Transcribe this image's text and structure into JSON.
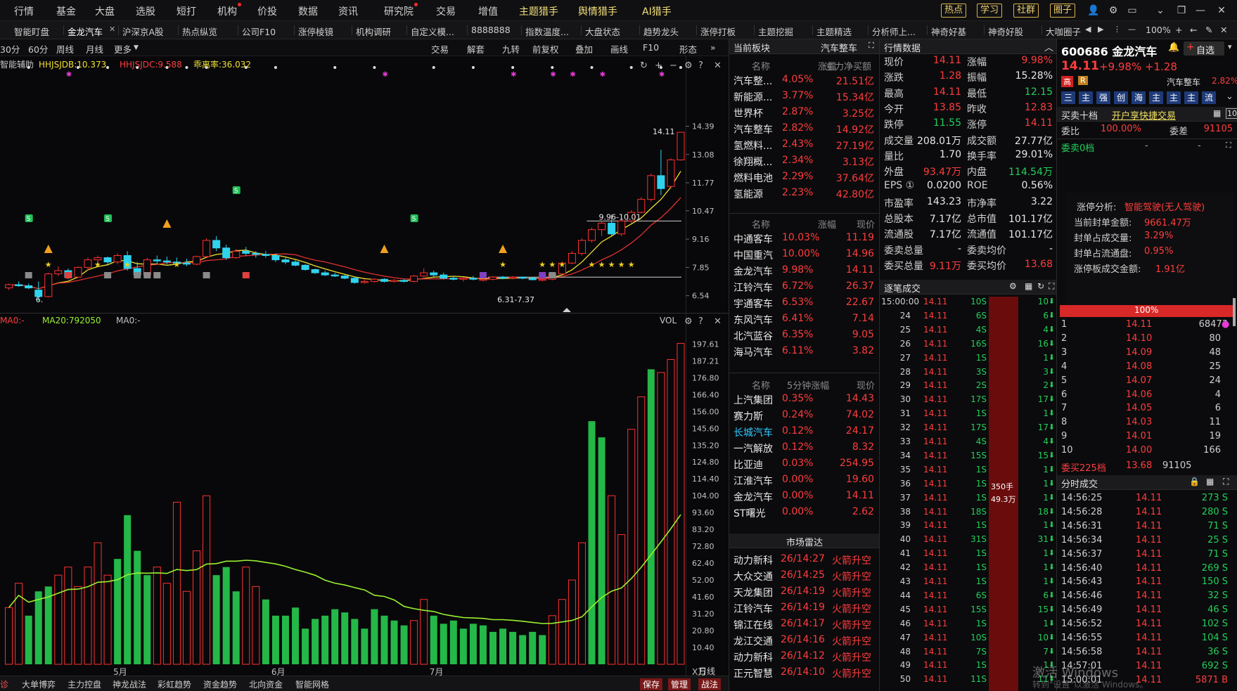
{
  "nav": {
    "items": [
      "行情",
      "基金",
      "大盘",
      "选股",
      "短打",
      "机构",
      "价投",
      "数据",
      "资讯",
      "研究院",
      "交易",
      "增值",
      "主题猎手",
      "舆情猎手",
      "AI猎手"
    ],
    "dots": [
      "机构",
      "研究院"
    ],
    "highlight": [
      "主题猎手",
      "舆情猎手",
      "AI猎手"
    ],
    "boxed": [
      "热点",
      "学习",
      "社群",
      "圈子"
    ]
  },
  "tabs": {
    "items": [
      "智能盯盘",
      "金龙汽车",
      "沪深京A股",
      "热点纵览",
      "公司F10",
      "涨停棱镜",
      "机构调研",
      "自定义模...",
      "8888888",
      "指数温度...",
      "大盘状态",
      "趋势龙头",
      "涨停打板",
      "主题挖掘",
      "主题精选",
      "分析师上...",
      "神奇好基",
      "神奇好股",
      "大咖圈子"
    ],
    "active": "金龙汽车",
    "zoom": "100%"
  },
  "chart_toolbar": {
    "periods": [
      "30分",
      "60分",
      "周线",
      "月线",
      "更多"
    ],
    "tools": [
      "交易",
      "解套",
      "九转",
      "前复权",
      "叠加",
      "画线",
      "F10",
      "形态"
    ]
  },
  "kline": {
    "indicator_name": "智能辅助",
    "ind1": "HHJSJDB:10.373",
    "ind2": "HHJSJDC:9.588",
    "ind3": "乖离率:36.032",
    "y_ticks": [
      "14.39",
      "13.08",
      "11.77",
      "10.47",
      "9.16",
      "7.85",
      "6.54"
    ],
    "ann_high": "14.11",
    "ann_range": "9.96-10.01",
    "ann_low1": "6.",
    "ann_low2": "6.31-7.37"
  },
  "volume": {
    "ma1": "MA0:-",
    "ma2": "MA20:792050",
    "ma3": "MA0:-",
    "label": "VOL",
    "unit": "X万",
    "y_ticks": [
      "197.61",
      "187.21",
      "176.80",
      "166.40",
      "156.00",
      "145.60",
      "135.20",
      "124.80",
      "114.40",
      "104.00",
      "93.60",
      "83.20",
      "72.80",
      "62.40",
      "52.00",
      "41.60",
      "31.20",
      "20.80",
      "10.40"
    ],
    "months": [
      "5月",
      "6月",
      "7月"
    ],
    "period_label": "日线"
  },
  "chart_data": {
    "type": "bar",
    "candles": [
      [
        6.9,
        7.1,
        6.8,
        7.05
      ],
      [
        7.05,
        7.2,
        6.95,
        7.0
      ],
      [
        7.0,
        7.1,
        6.85,
        6.9
      ],
      [
        6.8,
        7.2,
        6.3,
        6.5
      ],
      [
        6.5,
        7.6,
        6.45,
        7.55
      ],
      [
        7.55,
        7.9,
        7.45,
        7.7
      ],
      [
        7.7,
        7.8,
        7.3,
        7.4
      ],
      [
        7.4,
        7.9,
        7.35,
        7.85
      ],
      [
        7.85,
        8.3,
        7.7,
        8.2
      ],
      [
        8.2,
        8.4,
        8.0,
        8.3
      ],
      [
        8.3,
        8.35,
        8.0,
        8.1
      ],
      [
        8.1,
        8.5,
        8.0,
        8.4
      ],
      [
        8.4,
        8.6,
        7.7,
        7.8
      ],
      [
        7.8,
        8.1,
        7.4,
        7.5
      ],
      [
        7.5,
        8.3,
        7.45,
        8.2
      ],
      [
        8.2,
        8.4,
        8.0,
        8.15
      ],
      [
        8.15,
        8.35,
        8.0,
        8.1
      ],
      [
        8.1,
        8.3,
        8.0,
        8.05
      ],
      [
        8.05,
        8.25,
        7.9,
        8.0
      ],
      [
        8.0,
        8.4,
        7.95,
        8.35
      ],
      [
        8.35,
        9.2,
        8.3,
        9.1
      ],
      [
        9.1,
        9.3,
        8.6,
        8.75
      ],
      [
        8.75,
        8.9,
        8.2,
        8.3
      ],
      [
        8.3,
        8.7,
        8.25,
        8.6
      ],
      [
        8.6,
        8.8,
        8.4,
        8.5
      ],
      [
        8.5,
        8.6,
        8.3,
        8.45
      ],
      [
        8.45,
        8.6,
        8.3,
        8.4
      ],
      [
        8.4,
        8.5,
        8.1,
        8.2
      ],
      [
        8.2,
        8.3,
        8.0,
        8.1
      ],
      [
        8.1,
        8.2,
        7.9,
        7.95
      ],
      [
        7.95,
        8.0,
        7.7,
        7.75
      ],
      [
        7.75,
        7.8,
        7.55,
        7.6
      ],
      [
        7.6,
        7.7,
        7.45,
        7.5
      ],
      [
        7.5,
        7.6,
        7.4,
        7.45
      ],
      [
        7.45,
        7.5,
        7.3,
        7.35
      ],
      [
        7.35,
        7.4,
        7.1,
        7.15
      ],
      [
        7.15,
        7.3,
        7.1,
        7.2
      ],
      [
        7.2,
        7.35,
        7.15,
        7.3
      ],
      [
        7.3,
        7.35,
        7.15,
        7.2
      ],
      [
        7.2,
        7.3,
        7.15,
        7.25
      ],
      [
        7.25,
        7.3,
        7.15,
        7.2
      ],
      [
        7.2,
        7.5,
        7.15,
        7.45
      ],
      [
        7.45,
        7.8,
        7.4,
        7.6
      ],
      [
        7.6,
        7.7,
        7.4,
        7.5
      ],
      [
        7.5,
        7.6,
        7.3,
        7.35
      ],
      [
        7.35,
        7.45,
        7.25,
        7.3
      ],
      [
        7.3,
        7.4,
        7.2,
        7.35
      ],
      [
        7.35,
        7.45,
        7.25,
        7.3
      ],
      [
        7.3,
        7.4,
        7.2,
        7.3
      ],
      [
        7.3,
        7.45,
        7.25,
        7.4
      ],
      [
        7.4,
        7.45,
        7.3,
        7.35
      ],
      [
        7.35,
        7.45,
        7.3,
        7.4
      ],
      [
        7.4,
        7.42,
        7.3,
        7.35
      ],
      [
        7.35,
        7.4,
        7.25,
        7.28
      ],
      [
        7.28,
        7.35,
        7.2,
        7.3
      ],
      [
        7.3,
        7.6,
        7.25,
        7.55
      ],
      [
        7.55,
        8.1,
        7.5,
        8.05
      ],
      [
        8.05,
        8.6,
        8.0,
        8.5
      ],
      [
        8.5,
        9.2,
        8.4,
        9.1
      ],
      [
        9.1,
        9.7,
        9.0,
        9.6
      ],
      [
        9.6,
        10.0,
        9.3,
        9.9
      ],
      [
        9.9,
        10.3,
        9.3,
        9.4
      ],
      [
        9.4,
        10.1,
        9.3,
        10.0
      ],
      [
        10.0,
        10.5,
        9.9,
        10.4
      ],
      [
        10.4,
        11.1,
        10.35,
        11.0
      ],
      [
        11.0,
        12.2,
        10.9,
        12.1
      ],
      [
        12.1,
        13.3,
        11.2,
        11.5
      ],
      [
        11.6,
        12.9,
        11.5,
        12.83
      ],
      [
        12.83,
        14.11,
        12.8,
        14.11
      ]
    ],
    "volumes": [
      [
        35,
        1
      ],
      [
        50,
        1
      ],
      [
        30,
        0
      ],
      [
        45,
        0
      ],
      [
        48,
        0
      ],
      [
        55,
        1
      ],
      [
        60,
        1
      ],
      [
        48,
        1
      ],
      [
        60,
        1
      ],
      [
        75,
        1
      ],
      [
        55,
        1
      ],
      [
        65,
        0
      ],
      [
        92,
        0
      ],
      [
        70,
        0
      ],
      [
        55,
        0
      ],
      [
        60,
        1
      ],
      [
        50,
        1
      ],
      [
        100,
        1
      ],
      [
        45,
        1
      ],
      [
        70,
        1
      ],
      [
        104,
        1
      ],
      [
        55,
        0
      ],
      [
        60,
        0
      ],
      [
        45,
        0
      ],
      [
        60,
        1
      ],
      [
        48,
        1
      ],
      [
        40,
        0
      ],
      [
        30,
        0
      ],
      [
        30,
        0
      ],
      [
        35,
        0
      ],
      [
        22,
        0
      ],
      [
        28,
        0
      ],
      [
        30,
        0
      ],
      [
        34,
        0
      ],
      [
        32,
        0
      ],
      [
        28,
        0
      ],
      [
        22,
        0
      ],
      [
        34,
        0
      ],
      [
        30,
        0
      ],
      [
        27,
        0
      ],
      [
        24,
        0
      ],
      [
        27,
        1
      ],
      [
        40,
        1
      ],
      [
        30,
        0
      ],
      [
        25,
        0
      ],
      [
        27,
        0
      ],
      [
        22,
        0
      ],
      [
        25,
        0
      ],
      [
        24,
        0
      ],
      [
        20,
        0
      ],
      [
        22,
        0
      ],
      [
        20,
        0
      ],
      [
        18,
        0
      ],
      [
        20,
        0
      ],
      [
        18,
        0
      ],
      [
        30,
        1
      ],
      [
        40,
        1
      ],
      [
        52,
        1
      ],
      [
        75,
        1
      ],
      [
        150,
        0
      ],
      [
        140,
        0
      ],
      [
        104,
        1
      ],
      [
        80,
        1
      ],
      [
        145,
        1
      ],
      [
        165,
        1
      ],
      [
        182,
        0
      ],
      [
        180,
        1
      ],
      [
        188,
        1
      ],
      [
        198,
        1
      ]
    ],
    "y_range": [
      6.3,
      14.7
    ],
    "vol_max": 206
  },
  "sector_panel": {
    "title": "当前板块",
    "sector": "汽车整车",
    "head1": [
      "名称",
      "涨幅",
      "主力净买额"
    ],
    "rows1": [
      [
        "汽车整...",
        "4.05%",
        "21.51亿"
      ],
      [
        "新能源...",
        "3.77%",
        "15.34亿"
      ],
      [
        "世界杯",
        "2.87%",
        "3.25亿"
      ],
      [
        "汽车整车",
        "2.82%",
        "14.92亿"
      ],
      [
        "氢燃料...",
        "2.43%",
        "27.19亿"
      ],
      [
        "徐翔概...",
        "2.34%",
        "3.13亿"
      ],
      [
        "燃料电池",
        "2.29%",
        "37.64亿"
      ],
      [
        "氢能源",
        "2.23%",
        "42.80亿"
      ]
    ],
    "head2": [
      "名称",
      "涨幅",
      "现价"
    ],
    "rows2": [
      [
        "中通客车",
        "10.03%",
        "11.19"
      ],
      [
        "中国重汽",
        "10.00%",
        "14.96"
      ],
      [
        "金龙汽车",
        "9.98%",
        "14.11"
      ],
      [
        "江铃汽车",
        "6.72%",
        "26.37"
      ],
      [
        "宇通客车",
        "6.53%",
        "22.67"
      ],
      [
        "东风汽车",
        "6.41%",
        "7.14"
      ],
      [
        "北汽蓝谷",
        "6.35%",
        "9.05"
      ],
      [
        "海马汽车",
        "6.11%",
        "3.82"
      ]
    ],
    "head3": [
      "名称",
      "5分钟涨幅",
      "现价"
    ],
    "rows3": [
      [
        "上汽集团",
        "0.35%",
        "14.43"
      ],
      [
        "赛力斯",
        "0.24%",
        "74.02"
      ],
      [
        "长城汽车",
        "0.12%",
        "24.17"
      ],
      [
        "一汽解放",
        "0.12%",
        "8.32"
      ],
      [
        "比亚迪",
        "0.03%",
        "254.95"
      ],
      [
        "江淮汽车",
        "0.00%",
        "19.60"
      ],
      [
        "金龙汽车",
        "0.00%",
        "14.11"
      ],
      [
        "ST曙光",
        "0.00%",
        "2.62"
      ]
    ],
    "radar_title": "市场雷达",
    "radar": [
      [
        "动力新科",
        "26/14:27",
        "火箭升空"
      ],
      [
        "大众交通",
        "26/14:25",
        "火箭升空"
      ],
      [
        "天龙集团",
        "26/14:19",
        "火箭升空"
      ],
      [
        "江铃汽车",
        "26/14:19",
        "火箭升空"
      ],
      [
        "锦江在线",
        "26/14:17",
        "火箭升空"
      ],
      [
        "龙江交通",
        "26/14:16",
        "火箭升空"
      ],
      [
        "动力新科",
        "26/14:12",
        "火箭升空"
      ],
      [
        "正元智慧",
        "26/14:10",
        "火箭升空"
      ]
    ]
  },
  "quote": {
    "title": "行情数据",
    "rows": [
      [
        "现价",
        "14.11",
        "涨幅",
        "9.98%"
      ],
      [
        "涨跌",
        "1.28",
        "振幅",
        "15.28%"
      ],
      [
        "最高",
        "14.11",
        "最低",
        "12.15"
      ],
      [
        "今开",
        "13.85",
        "昨收",
        "12.83"
      ],
      [
        "跌停",
        "11.55",
        "涨停",
        "14.11"
      ],
      [
        "成交量",
        "208.01万",
        "成交额",
        "27.77亿"
      ],
      [
        "量比",
        "1.70",
        "换手率",
        "29.01%"
      ],
      [
        "外盘",
        "93.47万",
        "内盘",
        "114.54万"
      ],
      [
        "EPS ①",
        "0.0200",
        "ROE",
        "0.56%"
      ],
      [
        "市盈率",
        "143.23",
        "市净率",
        "3.22"
      ],
      [
        "总股本",
        "7.17亿",
        "总市值",
        "101.17亿"
      ],
      [
        "流通股",
        "7.17亿",
        "流通值",
        "101.17亿"
      ],
      [
        "委卖总量",
        "-",
        "委卖均价",
        "-"
      ],
      [
        "委买总量",
        "9.11万",
        "委买均价",
        "13.68"
      ]
    ]
  },
  "ticks": {
    "title": "逐笔成交",
    "rows": [
      [
        "15:00:00",
        "14.11",
        "10S",
        "10"
      ],
      [
        "24",
        "14.11",
        "6S",
        "6"
      ],
      [
        "25",
        "14.11",
        "4S",
        "4"
      ],
      [
        "26",
        "14.11",
        "16S",
        "16"
      ],
      [
        "27",
        "14.11",
        "1S",
        "1"
      ],
      [
        "28",
        "14.11",
        "3S",
        "3"
      ],
      [
        "29",
        "14.11",
        "2S",
        "2"
      ],
      [
        "30",
        "14.11",
        "17S",
        "17"
      ],
      [
        "31",
        "14.11",
        "1S",
        "1"
      ],
      [
        "32",
        "14.11",
        "17S",
        "17"
      ],
      [
        "33",
        "14.11",
        "4S",
        "4"
      ],
      [
        "34",
        "14.11",
        "15S",
        "15"
      ],
      [
        "35",
        "14.11",
        "1S",
        "1"
      ],
      [
        "36",
        "14.11",
        "1S",
        "1"
      ],
      [
        "37",
        "14.11",
        "1S",
        "1"
      ],
      [
        "38",
        "14.11",
        "18S",
        "18"
      ],
      [
        "39",
        "14.11",
        "1S",
        "1"
      ],
      [
        "40",
        "14.11",
        "31S",
        "31"
      ],
      [
        "41",
        "14.11",
        "1S",
        "1"
      ],
      [
        "42",
        "14.11",
        "1S",
        "1"
      ],
      [
        "43",
        "14.11",
        "1S",
        "1"
      ],
      [
        "44",
        "14.11",
        "6S",
        "6"
      ],
      [
        "45",
        "14.11",
        "15S",
        "15"
      ],
      [
        "46",
        "14.11",
        "1S",
        "1"
      ],
      [
        "47",
        "14.11",
        "10S",
        "10"
      ],
      [
        "48",
        "14.11",
        "7S",
        "7"
      ],
      [
        "49",
        "14.11",
        "1S",
        "1"
      ],
      [
        "50",
        "14.11",
        "11S",
        "11"
      ]
    ],
    "bar_text1": "350手",
    "bar_text2": "49.3万"
  },
  "stock": {
    "code_name": "600686 金龙汽车",
    "price": "14.11",
    "change": "+9.98% +1.28",
    "badge": "高",
    "badge2": "R",
    "sector_tag": "汽车整车",
    "sector_pct": "2.82%",
    "add_btn": "自选",
    "func_icons": [
      "三",
      "主",
      "强",
      "创",
      "海",
      "主",
      "主",
      "主",
      "流"
    ],
    "order_title": "买卖十档",
    "quick_trade": "开户享快捷交易",
    "wb_label": "委比",
    "wb_value": "100.00%",
    "wc_label": "委差",
    "wc_value": "91105",
    "sell0": "委卖0档",
    "limit_title": "涨停分析:",
    "limit_tag": "智能驾驶(无人驾驶)",
    "limit_rows": [
      [
        "当前封单金额:",
        "9661.47万"
      ],
      [
        "封单占成交量:",
        "3.29%"
      ],
      [
        "封单占流通盘:",
        "0.95%"
      ],
      [
        "涨停板成交金额:",
        "1.91亿"
      ]
    ],
    "bar_pct": "100%",
    "bids": [
      [
        "1",
        "14.11",
        "68473"
      ],
      [
        "2",
        "14.10",
        "80"
      ],
      [
        "3",
        "14.09",
        "48"
      ],
      [
        "4",
        "14.08",
        "25"
      ],
      [
        "5",
        "14.07",
        "24"
      ],
      [
        "6",
        "14.06",
        "4"
      ],
      [
        "7",
        "14.05",
        "6"
      ],
      [
        "8",
        "14.03",
        "11"
      ],
      [
        "9",
        "14.01",
        "19"
      ],
      [
        "10",
        "14.00",
        "166"
      ]
    ],
    "buy_total": [
      "委买225档",
      "13.68",
      "91105"
    ],
    "ftitle": "分时成交",
    "fen": [
      [
        "14:56:25",
        "14.11",
        "273 S"
      ],
      [
        "14:56:28",
        "14.11",
        "280 S"
      ],
      [
        "14:56:31",
        "14.11",
        "71 S"
      ],
      [
        "14:56:34",
        "14.11",
        "25 S"
      ],
      [
        "14:56:37",
        "14.11",
        "71 S"
      ],
      [
        "14:56:40",
        "14.11",
        "269 S"
      ],
      [
        "14:56:43",
        "14.11",
        "150 S"
      ],
      [
        "14:56:46",
        "14.11",
        "32 S"
      ],
      [
        "14:56:49",
        "14.11",
        "46 S"
      ],
      [
        "14:56:52",
        "14.11",
        "102 S"
      ],
      [
        "14:56:55",
        "14.11",
        "104 S"
      ],
      [
        "14:56:58",
        "14.11",
        "36 S"
      ],
      [
        "14:57:01",
        "14.11",
        "692 S"
      ],
      [
        "15:00:01",
        "14.11",
        "5871 B"
      ]
    ]
  },
  "bottom": {
    "tabs": [
      "大单博弈",
      "主力控盘",
      "神龙战法",
      "彩虹趋势",
      "资金趋势",
      "北向资金",
      "智能网格"
    ],
    "right": [
      "保存",
      "管理",
      "战法"
    ]
  },
  "watermark": {
    "line1": "激活 Windows",
    "line2": "转到\"设置\"以激活 Windows。"
  }
}
